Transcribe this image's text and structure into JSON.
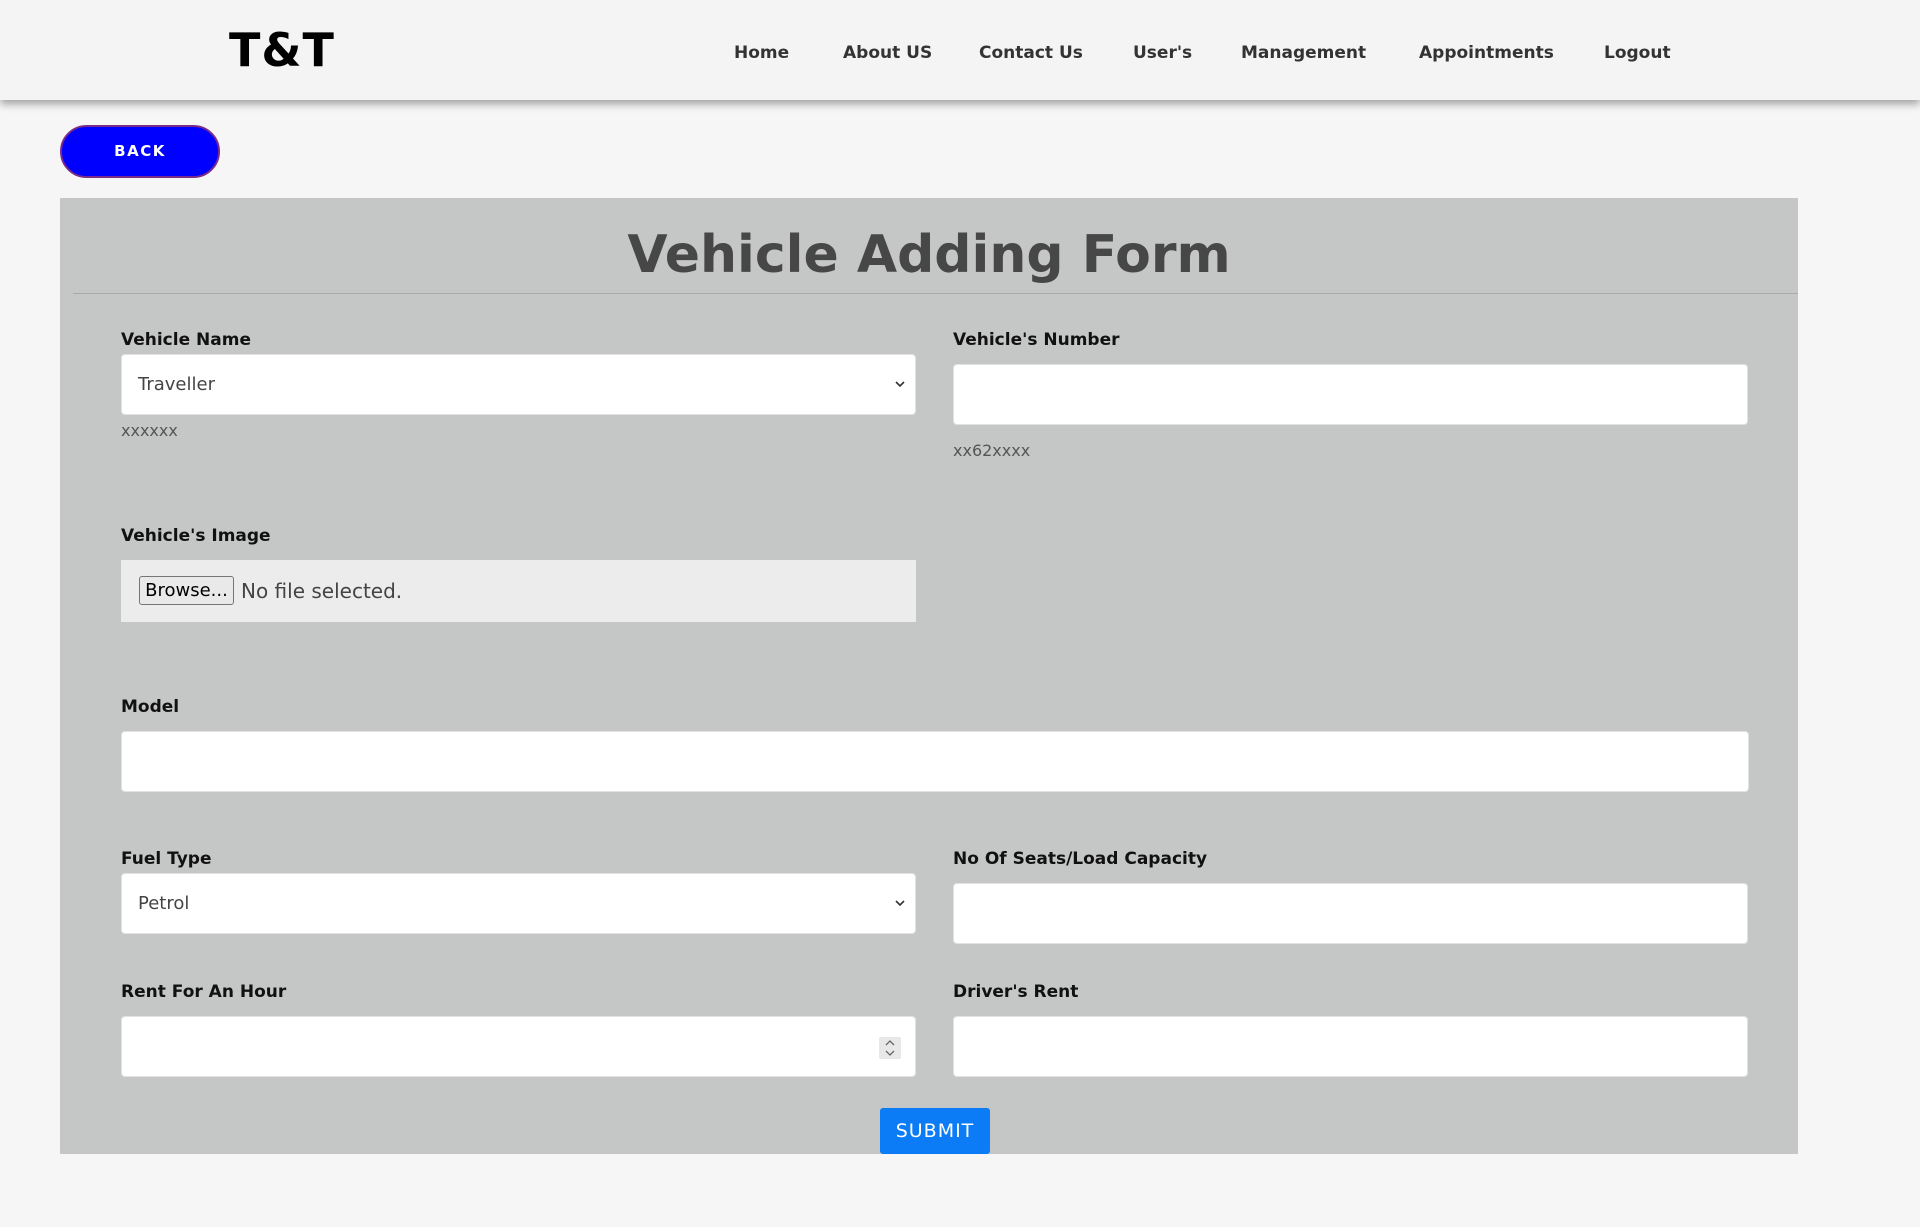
{
  "header": {
    "brand": "T&T",
    "nav": [
      {
        "label": "Home"
      },
      {
        "label": "About US"
      },
      {
        "label": "Contact Us"
      },
      {
        "label": "User's"
      },
      {
        "label": "Management"
      },
      {
        "label": "Appointments"
      },
      {
        "label": "Logout"
      }
    ]
  },
  "back_button": {
    "label": "BACK"
  },
  "form": {
    "title": "Vehicle Adding Form",
    "vehicle_name": {
      "label": "Vehicle Name",
      "selected": "Traveller",
      "hint": "xxxxxx"
    },
    "vehicle_number": {
      "label": "Vehicle's Number",
      "value": "",
      "hint": "xx62xxxx"
    },
    "vehicle_image": {
      "label": "Vehicle's Image",
      "browse_label": "Browse...",
      "status": "No file selected."
    },
    "model": {
      "label": "Model",
      "value": ""
    },
    "fuel_type": {
      "label": "Fuel Type",
      "selected": "Petrol"
    },
    "seats": {
      "label": "No Of Seats/Load Capacity",
      "value": ""
    },
    "rent_hour": {
      "label": "Rent For An Hour",
      "value": ""
    },
    "driver_rent": {
      "label": "Driver's Rent",
      "value": ""
    },
    "submit_label": "SUBMIT"
  },
  "colors": {
    "back_button": "#0000ff",
    "panel": "#c5c7c6",
    "submit": "#0b7cf6"
  }
}
